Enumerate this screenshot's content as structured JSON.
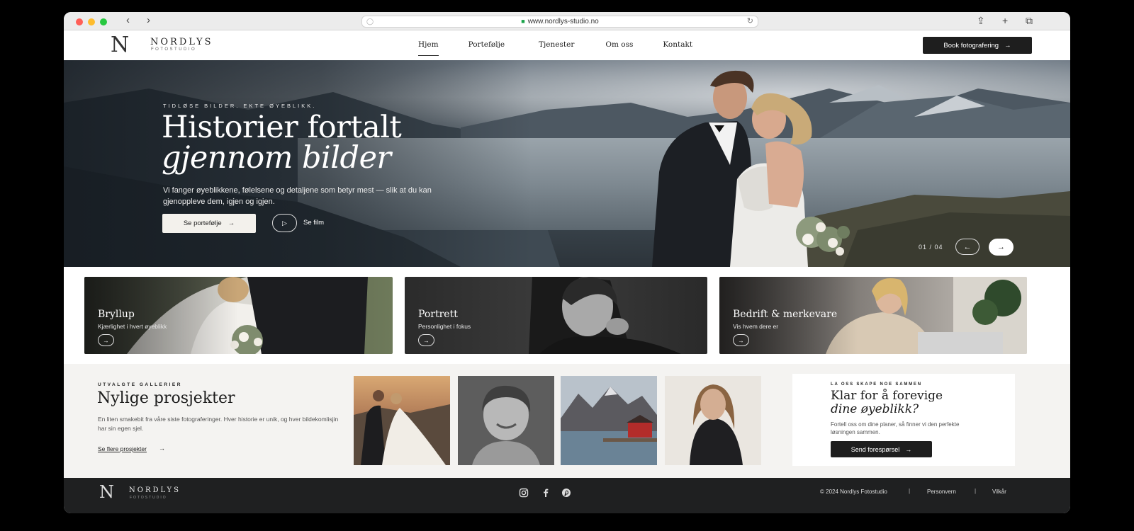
{
  "browser": {
    "url": "www.nordlys-studio.no"
  },
  "brand": {
    "mark": "N",
    "name": "NORDLYS",
    "tagline": "FOTOSTUDIO"
  },
  "nav": {
    "items": [
      {
        "label": "Hjem",
        "active": true
      },
      {
        "label": "Portefølje",
        "active": false
      },
      {
        "label": "Tjenester",
        "active": false
      },
      {
        "label": "Om oss",
        "active": false
      },
      {
        "label": "Kontakt",
        "active": false
      }
    ],
    "cta_label": "Book fotografering"
  },
  "hero": {
    "eyebrow": "TIDLØSE BILDER. EKTE ØYEBLIKK.",
    "title_line1": "Historier fortalt",
    "title_line2": "gjennom bilder",
    "description": "Vi fanger øyeblikkene, følelsene og detaljene som betyr mest — slik at du kan gjenoppleve dem, igjen og igjen.",
    "primary_button": "Se portefølje",
    "secondary_button": "Se film",
    "slide_counter": "01 / 04"
  },
  "categories": [
    {
      "title": "Bryllup",
      "subtitle": "Kjærlighet i hvert øyeblikk"
    },
    {
      "title": "Portrett",
      "subtitle": "Personlighet i fokus"
    },
    {
      "title": "Bedrift & merkevare",
      "subtitle": "Vis hvem dere er"
    }
  ],
  "projects": {
    "eyebrow": "UTVALGTE GALLERIER",
    "title": "Nylige prosjekter",
    "description": "En liten smakebit fra våre siste fotograferinger. Hver historie er unik, og hver bildekomlisjin har sin egen sjel.",
    "link": "Se flere prosjekter"
  },
  "cta": {
    "eyebrow": "LA OSS SKAPE NOE SAMMEN",
    "title_line1": "Klar for å forevige",
    "title_line2": "dine øyeblikk?",
    "description": "Fortell oss om dine planer, så finner vi den perfekte løsningen sammen.",
    "button": "Send forespørsel"
  },
  "footer": {
    "copyright": "© 2024 Nordlys Fotostudio",
    "links": [
      "Personvern",
      "Vilkår"
    ]
  },
  "icons": {
    "arrow": "→",
    "arrow_left": "←",
    "play": "▷",
    "back": "‹",
    "forward": "›",
    "share": "⇪",
    "new_tab": "+",
    "tabs": "⧉",
    "reload": "↻",
    "lock": "🔒",
    "separator": "|"
  }
}
